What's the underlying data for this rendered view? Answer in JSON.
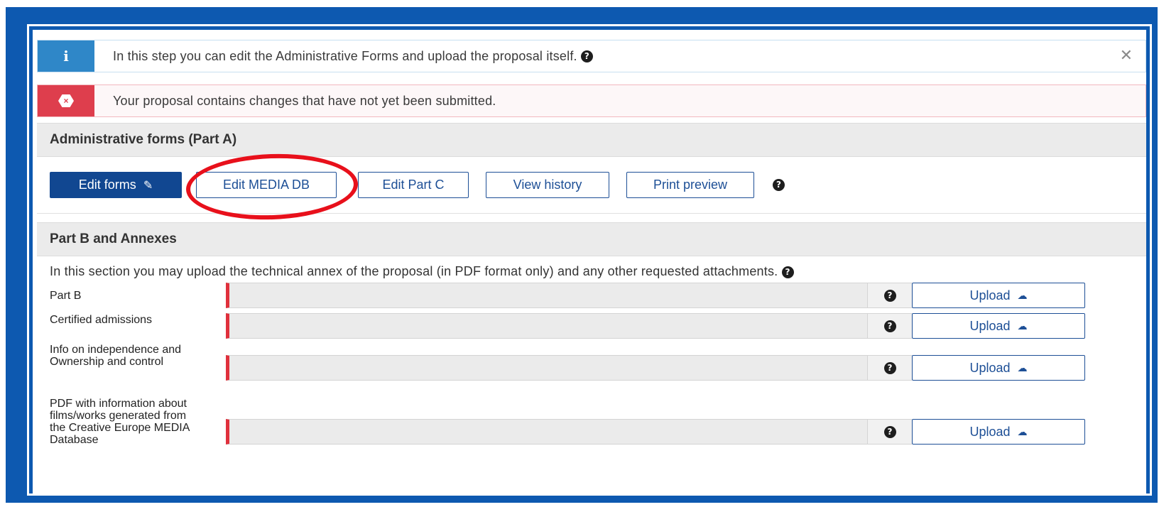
{
  "alerts": {
    "info": {
      "icon": "info-icon",
      "icon_glyph": "i",
      "text": "In this step you can edit the Administrative Forms and upload the proposal itself.",
      "close_glyph": "✕"
    },
    "error": {
      "icon": "error-icon",
      "icon_glyph": "×",
      "text": "Your proposal contains changes that have not yet been submitted."
    }
  },
  "part_a": {
    "title": "Administrative forms (Part A)",
    "buttons": {
      "edit_forms": "Edit forms",
      "edit_media_db": "Edit MEDIA DB",
      "edit_part_c": "Edit Part C",
      "view_history": "View history",
      "print_preview": "Print preview"
    }
  },
  "part_b": {
    "title": "Part B and Annexes",
    "description": "In this section you may upload the technical annex of the proposal (in PDF format only) and any other requested attachments.",
    "rows": [
      {
        "label": "Part B",
        "button": "Upload"
      },
      {
        "label": "Certified admissions",
        "button": "Upload"
      },
      {
        "label": "Info on independence and Ownership and control",
        "button": "Upload"
      },
      {
        "label": "PDF with information about films/works generated from the Creative Europe MEDIA Database",
        "button": "Upload"
      }
    ]
  },
  "glyphs": {
    "help": "?",
    "pencil": "✎",
    "cloud_upload": "☁"
  },
  "colors": {
    "frame": "#0d59b0",
    "primary": "#114791",
    "danger": "#de3e4d",
    "info": "#2f87c8",
    "annotation": "#e8101b"
  }
}
